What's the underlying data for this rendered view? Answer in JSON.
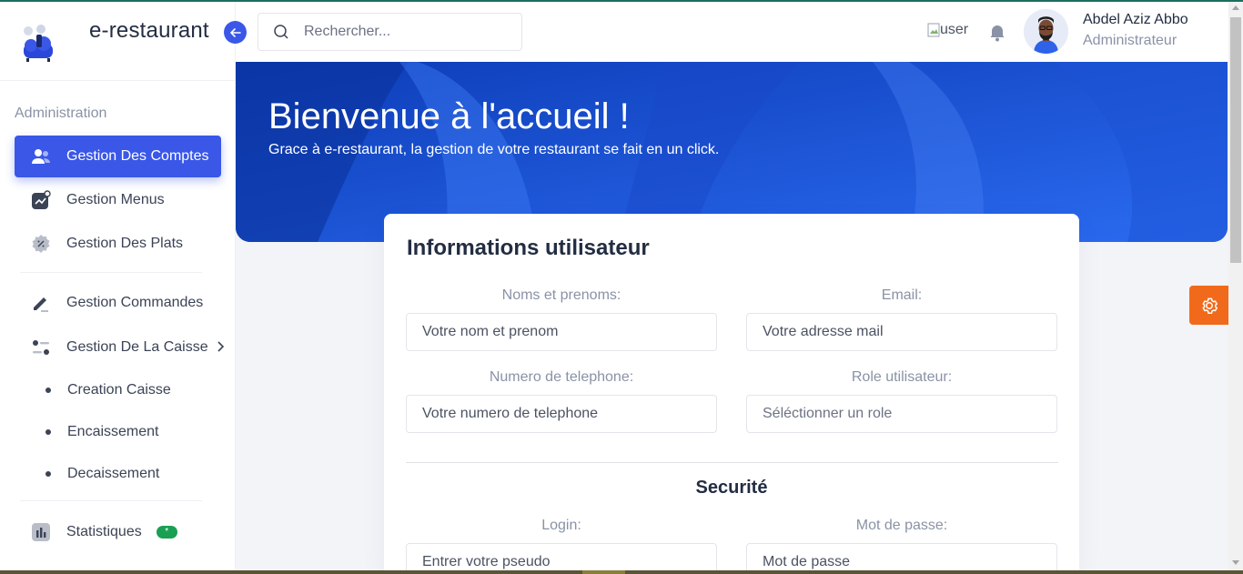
{
  "brand": {
    "name": "e-restaurant"
  },
  "sidebar": {
    "section": "Administration",
    "items": [
      {
        "label": "Gestion Des Comptes"
      },
      {
        "label": "Gestion Menus"
      },
      {
        "label": "Gestion Des Plats"
      },
      {
        "label": "Gestion Commandes"
      },
      {
        "label": "Gestion De La Caisse"
      },
      {
        "label": "Statistiques",
        "badge": "*"
      }
    ],
    "sub_items": [
      {
        "label": "Creation Caisse"
      },
      {
        "label": "Encaissement"
      },
      {
        "label": "Decaissement"
      }
    ]
  },
  "header": {
    "search_placeholder": "Rechercher...",
    "user_img_alt": "user",
    "user_name": "Abdel Aziz Abbo",
    "user_role": "Administrateur"
  },
  "banner": {
    "title": "Bienvenue à l'accueil !",
    "subtitle": "Grace à e-restaurant, la gestion de votre restaurant se fait en un click."
  },
  "form": {
    "title": "Informations utilisateur",
    "fields": [
      {
        "label": "Noms et prenoms:",
        "placeholder": "Votre nom et prenom"
      },
      {
        "label": "Email:",
        "placeholder": "Votre adresse mail"
      },
      {
        "label": "Numero de telephone:",
        "placeholder": "Votre numero de telephone"
      },
      {
        "label": "Role utilisateur:",
        "value": "Séléctionner un role"
      }
    ],
    "security_title": "Securité",
    "security_fields": [
      {
        "label": "Login:",
        "placeholder": "Entrer votre pseudo"
      },
      {
        "label": "Mot de passe:",
        "placeholder": "Mot de passe"
      }
    ]
  },
  "colors": {
    "primary": "#3a57e8",
    "settings": "#f16a1b",
    "badge": "#1aa053"
  }
}
